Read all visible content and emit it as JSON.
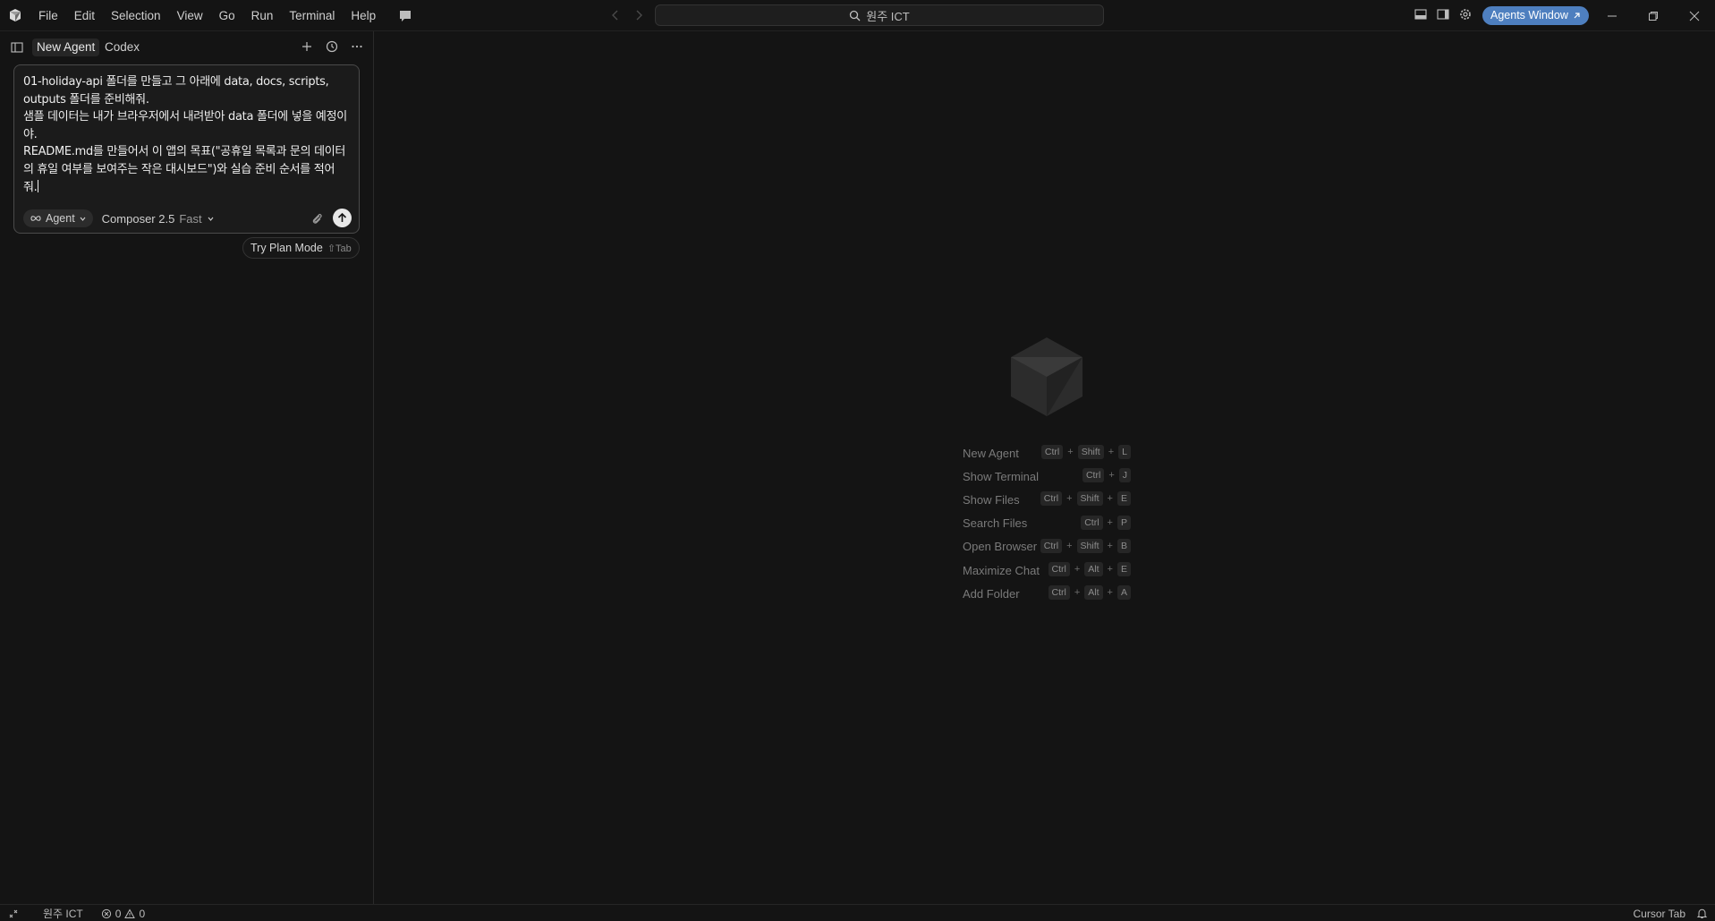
{
  "titlebar": {
    "menu": [
      "File",
      "Edit",
      "Selection",
      "View",
      "Go",
      "Run",
      "Terminal",
      "Help"
    ],
    "search_text": "원주 ICT",
    "agents_window_label": "Agents Window",
    "icons": {
      "logo": "cursor-logo-icon",
      "chat": "chat-bubble-icon",
      "back": "arrow-left-icon",
      "forward": "arrow-right-icon",
      "search": "search-icon",
      "layout_panel": "toggle-panel-icon",
      "layout_sidebar": "toggle-sidebar-icon",
      "settings": "gear-icon",
      "external": "external-link-icon",
      "minimize": "minimize-icon",
      "restore": "restore-icon",
      "close": "close-icon"
    }
  },
  "sidebar": {
    "tabs": [
      {
        "label": "New Agent",
        "active": true
      },
      {
        "label": "Codex",
        "active": false
      }
    ],
    "composer": {
      "text": "01-holiday-api 폴더를 만들고 그 아래에 data, docs, scripts,\noutputs 폴더를 준비해줘.\n샘플 데이터는 내가 브라우저에서 내려받아 data 폴더에 넣을 예정이\n야.\nREADME.md를 만들어서 이 앱의 목표(\"공휴일 목록과 문의 데이터\n의 휴일 여부를 보여주는 작은 대시보드\")와 실습 준비 순서를 적어\n줘.",
      "mode_label": "Agent",
      "model_label": "Composer 2.5",
      "model_speed": "Fast"
    },
    "plan_hint": {
      "label": "Try Plan Mode",
      "shortcut": "⇧Tab"
    }
  },
  "main": {
    "shortcuts": [
      {
        "label": "New Agent",
        "keys": [
          "Ctrl",
          "Shift",
          "L"
        ]
      },
      {
        "label": "Show Terminal",
        "keys": [
          "Ctrl",
          "J"
        ]
      },
      {
        "label": "Show Files",
        "keys": [
          "Ctrl",
          "Shift",
          "E"
        ]
      },
      {
        "label": "Search Files",
        "keys": [
          "Ctrl",
          "P"
        ]
      },
      {
        "label": "Open Browser",
        "keys": [
          "Ctrl",
          "Shift",
          "B"
        ]
      },
      {
        "label": "Maximize Chat",
        "keys": [
          "Ctrl",
          "Alt",
          "E"
        ]
      },
      {
        "label": "Add Folder",
        "keys": [
          "Ctrl",
          "Alt",
          "A"
        ]
      }
    ]
  },
  "statusbar": {
    "workspace": "원주 ICT",
    "errors": "0",
    "warnings": "0",
    "right_label": "Cursor Tab"
  },
  "colors": {
    "background": "#141414",
    "accent": "#4e7fbf",
    "border": "#2a2a2a"
  }
}
